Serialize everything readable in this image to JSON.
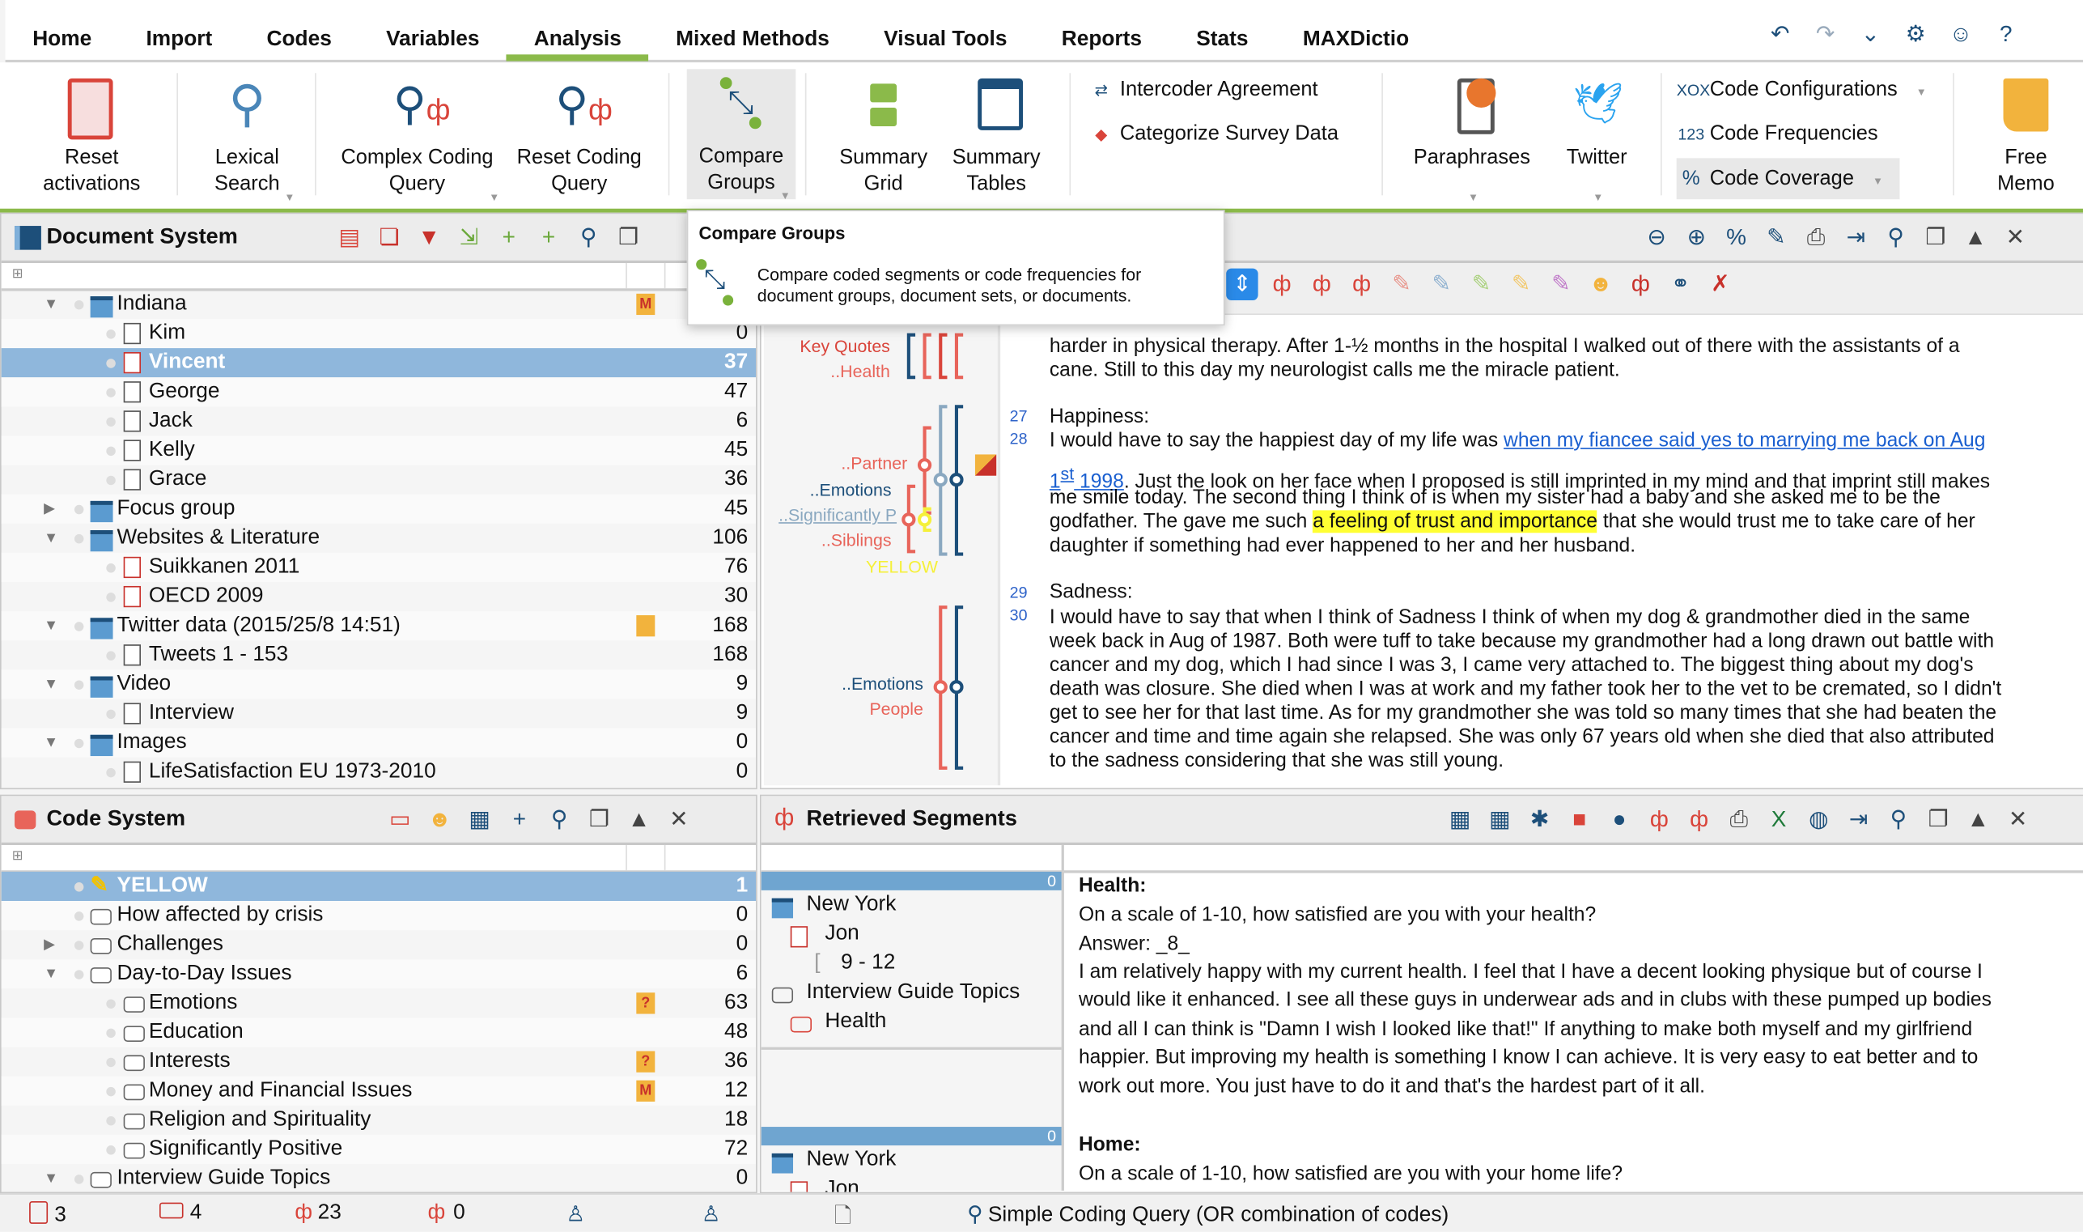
{
  "colors": {
    "accent": "#8bba4a",
    "selection": "#8fb7dc",
    "navy": "#1d4f7a",
    "red": "#c8312b",
    "highlight": "#ffff33",
    "link": "#1a5fd0"
  },
  "tabs": [
    "Home",
    "Import",
    "Codes",
    "Variables",
    "Analysis",
    "Mixed Methods",
    "Visual Tools",
    "Reports",
    "Stats",
    "MAXDictio"
  ],
  "active_tab": "Analysis",
  "top_icons": [
    "undo-icon",
    "redo-icon",
    "chevron-down-icon",
    "gear-icon",
    "smiley-icon",
    "help-icon"
  ],
  "ribbon": {
    "reset_activations": [
      "Reset",
      "activations"
    ],
    "lexical_search": [
      "Lexical",
      "Search"
    ],
    "complex_coding_query": [
      "Complex Coding",
      "Query"
    ],
    "reset_coding_query": [
      "Reset Coding",
      "Query"
    ],
    "compare_groups": [
      "Compare",
      "Groups"
    ],
    "summary_grid": [
      "Summary",
      "Grid"
    ],
    "summary_tables": [
      "Summary",
      "Tables"
    ],
    "intercoder": "Intercoder Agreement",
    "categorize": "Categorize Survey Data",
    "paraphrases": "Paraphrases",
    "twitter": "Twitter",
    "code_configurations": {
      "prefix": "XOX",
      "label": "Code Configurations"
    },
    "code_frequencies": {
      "prefix": "123",
      "label": "Code Frequencies"
    },
    "code_coverage": {
      "prefix": "%",
      "label": "Code Coverage"
    },
    "free_memo": [
      "Free",
      "Memo"
    ]
  },
  "tooltip": {
    "title": "Compare Groups",
    "lines": [
      "Compare coded segments or code frequencies for",
      "document groups, document sets, or documents."
    ]
  },
  "document_system": {
    "title": "Document System",
    "toolbar": [
      "reset-activations-icon",
      "copy-documents-icon",
      "filter-documents-icon",
      "import-icon",
      "new-document-icon",
      "new-folder-icon",
      "search-icon",
      "restore-window-icon"
    ],
    "rows": [
      {
        "label": "Indiana",
        "count": "",
        "level": 0,
        "expand": "open",
        "icon": "folder",
        "memo": "M"
      },
      {
        "label": "Kim",
        "count": "0",
        "level": 1,
        "icon": "doc"
      },
      {
        "label": "Vincent",
        "count": "37",
        "level": 1,
        "icon": "doc-red",
        "selected": true
      },
      {
        "label": "George",
        "count": "47",
        "level": 1,
        "icon": "doc"
      },
      {
        "label": "Jack",
        "count": "6",
        "level": 1,
        "icon": "doc"
      },
      {
        "label": "Kelly",
        "count": "45",
        "level": 1,
        "icon": "doc"
      },
      {
        "label": "Grace",
        "count": "36",
        "level": 1,
        "icon": "doc"
      },
      {
        "label": "Focus group",
        "count": "45",
        "level": 0,
        "expand": "closed",
        "icon": "folder"
      },
      {
        "label": "Websites & Literature",
        "count": "106",
        "level": 0,
        "expand": "open",
        "icon": "folder"
      },
      {
        "label": "Suikkanen 2011",
        "count": "76",
        "level": 1,
        "icon": "pdf"
      },
      {
        "label": "OECD 2009",
        "count": "30",
        "level": 1,
        "icon": "pdf"
      },
      {
        "label": "Twitter data (2015/25/8 14:51)",
        "count": "168",
        "level": 0,
        "expand": "open",
        "icon": "folder",
        "memo": " "
      },
      {
        "label": "Tweets 1 - 153",
        "count": "168",
        "level": 1,
        "icon": "table"
      },
      {
        "label": "Video",
        "count": "9",
        "level": 0,
        "expand": "open",
        "icon": "folder"
      },
      {
        "label": "Interview",
        "count": "9",
        "level": 1,
        "icon": "video"
      },
      {
        "label": "Images",
        "count": "0",
        "level": 0,
        "expand": "open",
        "icon": "folder"
      },
      {
        "label": "LifeSatisfaction EU 1973-2010",
        "count": "0",
        "level": 1,
        "icon": "image"
      }
    ]
  },
  "document_browser": {
    "toolbar": [
      "zoom-out-icon",
      "zoom-in-icon",
      "zoom-100-icon",
      "edit-icon",
      "print-icon",
      "export-icon",
      "search-icon",
      "restore-window-icon",
      "maximize-icon",
      "close-icon"
    ],
    "coding_toolbar": [
      "navigate-updown-icon",
      "code-icon",
      "add-code-icon",
      "add-code-info-icon",
      "highlighter-red-icon",
      "highlighter-blue-icon",
      "highlighter-green-icon",
      "highlighter-yellow-icon",
      "highlighter-purple-icon",
      "emoticon-icon",
      "undo-code-icon",
      "link-add-icon",
      "link-delete-icon"
    ],
    "line_numbers": [
      "27",
      "28",
      "29",
      "30"
    ],
    "margin_labels": [
      {
        "text": "Key Quotes",
        "color": "#d9443a"
      },
      {
        "text": "..Health",
        "color": "#e8645a"
      },
      {
        "text": "..Partner",
        "color": "#e8645a"
      },
      {
        "text": "..Emotions",
        "color": "#1d4f7a"
      },
      {
        "text": "..Significantly P",
        "color": "#8aa8c0"
      },
      {
        "text": "..Siblings",
        "color": "#e8645a"
      },
      {
        "text": "YELLOW",
        "color": "#f5f03a"
      },
      {
        "text": "..Emotions",
        "color": "#1d4f7a"
      },
      {
        "text": "People",
        "color": "#e8645a"
      }
    ],
    "lines": [
      [
        {
          "t": "harder in physical therapy. After 1-½ months in the hospital I walked out of there with the assistants of a"
        }
      ],
      [
        {
          "t": "cane. Still to this day my neurologist calls me the miracle patient."
        }
      ],
      [
        {
          "t": "Happiness:"
        }
      ],
      [
        {
          "t": "I would have to say the happiest day of my life was "
        },
        {
          "t": "when my fiancee said yes to marrying me back on Aug",
          "s": "link"
        }
      ],
      [
        {
          "t": "1",
          "s": "link"
        },
        {
          "t": "st",
          "s": "link sup"
        },
        {
          "t": " 1998",
          "s": "link"
        },
        {
          "t": ". Just the look on her face when I proposed is still imprinted in my mind and that imprint still makes"
        }
      ],
      [
        {
          "t": "me smile today. The second thing I think of is when my sister had a baby and she asked me to be the"
        }
      ],
      [
        {
          "t": "godfather. The gave me such "
        },
        {
          "t": "a feeling of trust and importance",
          "s": "hl"
        },
        {
          "t": " that she would trust me to take care of her"
        }
      ],
      [
        {
          "t": "daughter if something had ever happened to her and her husband."
        }
      ],
      [
        {
          "t": "Sadness:"
        }
      ],
      [
        {
          "t": "I would have to say that when I think of Sadness I think of when my dog & grandmother died in the same"
        }
      ],
      [
        {
          "t": "week back in Aug of 1987. Both were tuff to take because my grandmother had a long drawn out battle with"
        }
      ],
      [
        {
          "t": "cancer and my dog, which I had since I was 3, I came very attached to. The biggest thing about my dog's"
        }
      ],
      [
        {
          "t": "death was closure. She died when I was at work and my father took her to the vet to be cremated, so I didn't"
        }
      ],
      [
        {
          "t": "get to see her for that last time. As for my grandmother she was told so many times that she had beaten the"
        }
      ],
      [
        {
          "t": "cancer and time and time again she relapsed. She was only 67 years old when she died that also attributed"
        }
      ],
      [
        {
          "t": "to the sadness considering that she was still young."
        }
      ]
    ]
  },
  "code_system": {
    "title": "Code System",
    "toolbar": [
      "code-memo-icon",
      "emoticon-icon",
      "table-icon",
      "new-code-icon",
      "search-icon",
      "restore-window-icon",
      "maximize-icon",
      "close-icon"
    ],
    "rows": [
      {
        "label": "YELLOW",
        "count": "1",
        "level": 0,
        "icon": "pen",
        "selected": true
      },
      {
        "label": "How affected by crisis",
        "count": "0",
        "level": 0,
        "icon": "code"
      },
      {
        "label": "Challenges",
        "count": "0",
        "level": 0,
        "expand": "closed",
        "icon": "code"
      },
      {
        "label": "Day-to-Day Issues",
        "count": "6",
        "level": 0,
        "expand": "open",
        "icon": "code"
      },
      {
        "label": "Emotions",
        "count": "63",
        "level": 1,
        "icon": "code",
        "memo": "?"
      },
      {
        "label": "Education",
        "count": "48",
        "level": 1,
        "icon": "code"
      },
      {
        "label": "Interests",
        "count": "36",
        "level": 1,
        "icon": "code",
        "memo": "?"
      },
      {
        "label": "Money and Financial Issues",
        "count": "12",
        "level": 1,
        "icon": "code",
        "memo": "M"
      },
      {
        "label": "Religion and Spirituality",
        "count": "18",
        "level": 1,
        "icon": "code"
      },
      {
        "label": "Significantly Positive",
        "count": "72",
        "level": 1,
        "icon": "code"
      },
      {
        "label": "Interview Guide Topics",
        "count": "0",
        "level": 0,
        "expand": "open",
        "icon": "code"
      }
    ]
  },
  "retrieved_segments": {
    "title": "Retrieved Segments",
    "toolbar": [
      "table-icon",
      "overview-icon",
      "lightbulb-icon",
      "color-icon",
      "spellcheck-icon",
      "code-icon",
      "add-code-icon",
      "print-icon",
      "excel-icon",
      "web-icon",
      "export-icon",
      "search-icon",
      "restore-window-icon",
      "maximize-icon",
      "close-icon"
    ],
    "groups": [
      {
        "count": "0",
        "folder": "New York",
        "doc": "Jon",
        "range": "9 - 12",
        "code_parent": "Interview Guide Topics",
        "code": "Health"
      },
      {
        "count": "0",
        "folder": "New York",
        "doc": "Jon"
      }
    ],
    "text": [
      {
        "t": "Health:",
        "b": true
      },
      {
        "t": "On a scale of 1-10, how satisfied are you with your health?"
      },
      {
        "t": "Answer:  _8_"
      },
      {
        "t": "I am relatively happy with my current health.  I feel that I have a decent looking physique but of course I"
      },
      {
        "t": "would like it enhanced.  I see all these guys in underwear ads and in clubs with these pumped up bodies"
      },
      {
        "t": "and all I can think is \"Damn I wish I looked like that!\"  If anything to make both myself and my girlfriend"
      },
      {
        "t": "happier.  But improving my health is something I know I can achieve.  It is very easy to eat better and to"
      },
      {
        "t": "work out more.  You just have to do it and that's the hardest part of it all."
      },
      {
        "t": "Home:",
        "b": true
      },
      {
        "t": "On a scale of 1-10, how satisfied are you with your home life?"
      }
    ]
  },
  "status_bar": {
    "documents": "3",
    "codes": "4",
    "segments": "23",
    "weighted": "0",
    "query": "Simple Coding Query (OR combination of codes)"
  }
}
